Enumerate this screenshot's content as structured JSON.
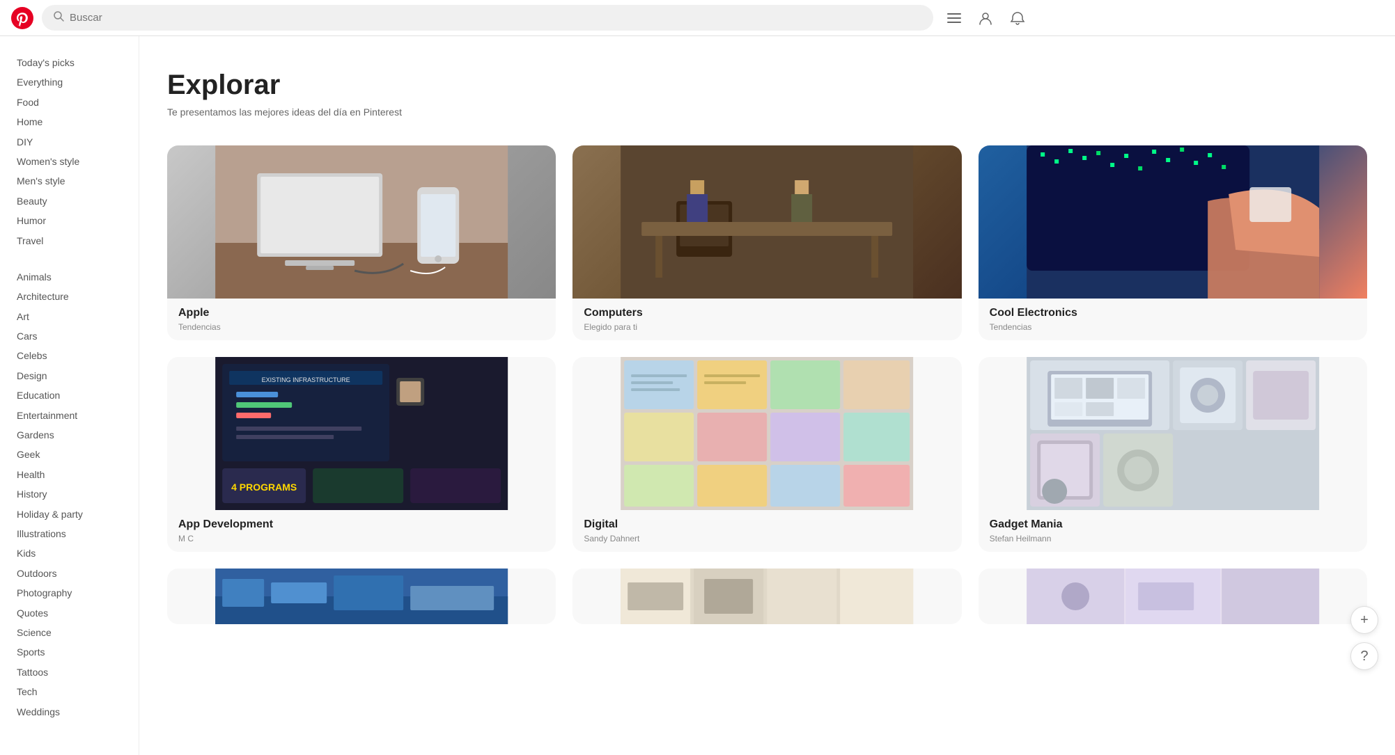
{
  "header": {
    "search_placeholder": "Buscar",
    "logo_alt": "Pinterest"
  },
  "page": {
    "title": "Explorar",
    "subtitle": "Te presentamos las mejores ideas del día en Pinterest"
  },
  "sidebar": {
    "primary_items": [
      {
        "label": "Today's picks",
        "active": false
      },
      {
        "label": "Everything",
        "active": false
      },
      {
        "label": "Food",
        "active": false
      },
      {
        "label": "Home",
        "active": false
      },
      {
        "label": "DIY",
        "active": false
      },
      {
        "label": "Women's style",
        "active": false
      },
      {
        "label": "Men's style",
        "active": false
      },
      {
        "label": "Beauty",
        "active": false
      },
      {
        "label": "Humor",
        "active": false
      },
      {
        "label": "Travel",
        "active": false
      }
    ],
    "secondary_items": [
      {
        "label": "Animals"
      },
      {
        "label": "Architecture"
      },
      {
        "label": "Art"
      },
      {
        "label": "Cars"
      },
      {
        "label": "Celebs"
      },
      {
        "label": "Design"
      },
      {
        "label": "Education"
      },
      {
        "label": "Entertainment"
      },
      {
        "label": "Gardens"
      },
      {
        "label": "Geek"
      },
      {
        "label": "Health"
      },
      {
        "label": "History"
      },
      {
        "label": "Holiday & party"
      },
      {
        "label": "Illustrations"
      },
      {
        "label": "Kids"
      },
      {
        "label": "Outdoors"
      },
      {
        "label": "Photography"
      },
      {
        "label": "Quotes"
      },
      {
        "label": "Science"
      },
      {
        "label": "Sports"
      },
      {
        "label": "Tattoos"
      },
      {
        "label": "Tech"
      },
      {
        "label": "Weddings"
      }
    ]
  },
  "pins": [
    {
      "id": "apple",
      "title": "Apple",
      "meta": "Tendencias",
      "image_type": "apple"
    },
    {
      "id": "computers",
      "title": "Computers",
      "meta": "Elegido para ti",
      "image_type": "computers"
    },
    {
      "id": "cool-electronics",
      "title": "Cool Electronics",
      "meta": "Tendencias",
      "image_type": "cool-electronics"
    },
    {
      "id": "app-development",
      "title": "App Development",
      "meta": "M C",
      "image_type": "app-dev"
    },
    {
      "id": "digital",
      "title": "Digital",
      "meta": "Sandy Dahnert",
      "image_type": "digital"
    },
    {
      "id": "gadget-mania",
      "title": "Gadget Mania",
      "meta": "Stefan Heilmann",
      "image_type": "gadget"
    }
  ],
  "fab": {
    "add_label": "+",
    "help_label": "?"
  }
}
